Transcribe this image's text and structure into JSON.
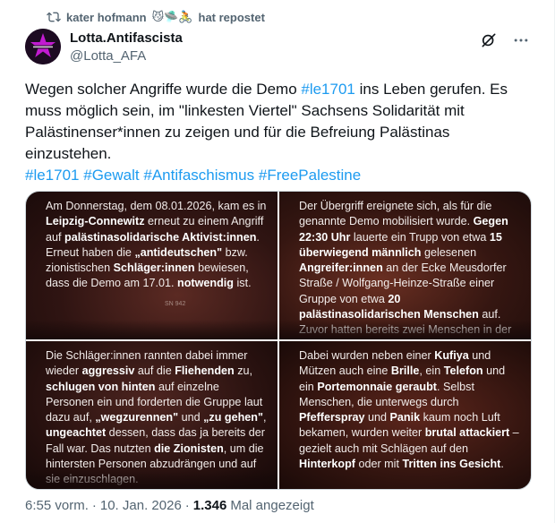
{
  "repost": {
    "text": "kater hofmann",
    "emojis": "😼🛸🚴",
    "suffix": "hat repostet"
  },
  "author": {
    "display_name": "Lotta.Antifascista",
    "handle": "@Lotta_AFA",
    "avatar_label": "LOTTA ANTIFA"
  },
  "tweet": {
    "text_part1": "Wegen solcher Angriffe wurde die Demo ",
    "hashtag_inline": "#le1701",
    "text_part2": " ins Leben gerufen. Es muss möglich sein, im \"linkesten Viertel\" Sachsens Solidarität mit Palästinenser*innen zu zeigen und für die Befreiung Palästinas einzustehen.",
    "hashtags": [
      "#le1701",
      "#Gewalt",
      "#Antifaschismus",
      "#FreePalestine"
    ]
  },
  "images": {
    "tile1": {
      "segments": [
        {
          "t": "Am Donnerstag, dem 08.01.2026, kam es in ",
          "b": false
        },
        {
          "t": "Leipzig-Connewitz",
          "b": true
        },
        {
          "t": " erneut zu einem Angriff auf ",
          "b": false
        },
        {
          "t": "palästinasolidarische Aktivist:innen",
          "b": true
        },
        {
          "t": ". Erneut haben die ",
          "b": false
        },
        {
          "t": "„antideutschen\"",
          "b": true
        },
        {
          "t": " bzw. zionistischen ",
          "b": false
        },
        {
          "t": "Schläger:innen",
          "b": true
        },
        {
          "t": " bewiesen, dass die Demo am 17.01. ",
          "b": false
        },
        {
          "t": "notwendig",
          "b": true
        },
        {
          "t": " ist.",
          "b": false
        }
      ],
      "sign": "SN 942"
    },
    "tile2": {
      "segments": [
        {
          "t": "Der Übergriff ereignete sich, als für die genannte Demo mobilisiert wurde. ",
          "b": false
        },
        {
          "t": "Gegen 22:30 Uhr",
          "b": true
        },
        {
          "t": " lauerte ein Trupp von etwa ",
          "b": false
        },
        {
          "t": "15 überwiegend männlich",
          "b": true
        },
        {
          "t": " gelesenen ",
          "b": false
        },
        {
          "t": "Angreifer:innen",
          "b": true
        },
        {
          "t": " an der Ecke Meusdorfer Straße / Wolfgang-Heinze-Straße einer Gruppe von etwa ",
          "b": false
        },
        {
          "t": "20 palästinasolidarischen Menschen",
          "b": true
        },
        {
          "t": " auf. Zuvor hatten bereits zwei Menschen in der Gruppe von etwa",
          "b": false
        }
      ]
    },
    "tile3": {
      "segments": [
        {
          "t": "Die Schläger:innen rannten dabei immer wieder ",
          "b": false
        },
        {
          "t": "aggressiv",
          "b": true
        },
        {
          "t": " auf die ",
          "b": false
        },
        {
          "t": "Fliehenden",
          "b": true
        },
        {
          "t": " zu, ",
          "b": false
        },
        {
          "t": "schlugen von hinten",
          "b": true
        },
        {
          "t": " auf einzelne Personen ein und forderten die Gruppe laut dazu auf, ",
          "b": false
        },
        {
          "t": "„wegzurennen\"",
          "b": true
        },
        {
          "t": " und ",
          "b": false
        },
        {
          "t": "„zu gehen\"",
          "b": true
        },
        {
          "t": ", ",
          "b": false
        },
        {
          "t": "ungeachtet",
          "b": true
        },
        {
          "t": " dessen, dass das ja bereits der Fall war. Das nutzten ",
          "b": false
        },
        {
          "t": "die Zionisten",
          "b": true
        },
        {
          "t": ", um die hintersten Personen abzudrängen und auf sie einzuschlagen.",
          "b": false
        }
      ]
    },
    "tile4": {
      "segments": [
        {
          "t": "Dabei wurden neben einer ",
          "b": false
        },
        {
          "t": "Kufiya",
          "b": true
        },
        {
          "t": " und Mützen auch eine ",
          "b": false
        },
        {
          "t": "Brille",
          "b": true
        },
        {
          "t": ", ein ",
          "b": false
        },
        {
          "t": "Telefon",
          "b": true
        },
        {
          "t": " und ein ",
          "b": false
        },
        {
          "t": "Portemonnaie geraubt",
          "b": true
        },
        {
          "t": ". Selbst Menschen, die unterwegs durch ",
          "b": false
        },
        {
          "t": "Pfefferspray",
          "b": true
        },
        {
          "t": " und ",
          "b": false
        },
        {
          "t": "Panik",
          "b": true
        },
        {
          "t": " kaum noch Luft bekamen, wurden weiter ",
          "b": false
        },
        {
          "t": "brutal attackiert",
          "b": true
        },
        {
          "t": " – gezielt auch mit Schlägen auf den ",
          "b": false
        },
        {
          "t": "Hinterkopf",
          "b": true
        },
        {
          "t": " oder mit ",
          "b": false
        },
        {
          "t": "Tritten ins Gesicht",
          "b": true
        },
        {
          "t": ".",
          "b": false
        }
      ]
    }
  },
  "meta": {
    "time": "6:55 vorm.",
    "separator": "·",
    "date": "10. Jan. 2026",
    "views_count": "1.346",
    "views_label": "Mal angezeigt"
  },
  "colors": {
    "accent": "#1d9bf0",
    "secondary_text": "#536471",
    "primary_text": "#0f1419"
  }
}
